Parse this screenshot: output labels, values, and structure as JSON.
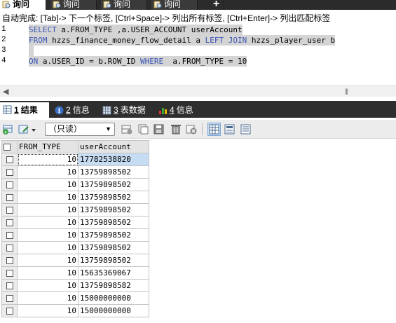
{
  "query_tabs": [
    {
      "label": "询问",
      "active": true
    },
    {
      "label": "询问",
      "active": false
    },
    {
      "label": "询问",
      "active": false
    },
    {
      "label": "询问",
      "active": false
    }
  ],
  "new_tab_label": "+",
  "hint": "自动完成: [Tab]-> 下一个标签, [Ctrl+Space]-> 列出所有标签, [Ctrl+Enter]-> 列出匹配标签",
  "editor": {
    "line_numbers": [
      "1",
      "2",
      "3",
      "4"
    ],
    "lines": [
      [
        {
          "t": "SELECT",
          "kw": true
        },
        {
          "t": " a.FROM_TYPE ,a.USER_ACCOUNT userAccount",
          "kw": false
        }
      ],
      [
        {
          "t": "FROM",
          "kw": true
        },
        {
          "t": " hzzs_finance_money_flow_detail a ",
          "kw": false
        },
        {
          "t": "LEFT JOIN",
          "kw": true
        },
        {
          "t": " hzzs_player_user b",
          "kw": false
        }
      ],
      [
        {
          "t": " ",
          "kw": false
        }
      ],
      [
        {
          "t": "ON",
          "kw": true
        },
        {
          "t": " a.USER_ID = b.ROW_ID ",
          "kw": false
        },
        {
          "t": "WHERE",
          "kw": true
        },
        {
          "t": "  a.FROM_TYPE = 10",
          "kw": false
        }
      ]
    ]
  },
  "result_tabs": [
    {
      "num": "1",
      "label": "结果",
      "icon": "grid-icon",
      "active": true
    },
    {
      "num": "2",
      "label": "信息",
      "icon": "info-icon",
      "active": false
    },
    {
      "num": "3",
      "label": "表数据",
      "icon": "table-icon",
      "active": false
    },
    {
      "num": "4",
      "label": "信息",
      "icon": "chart-icon",
      "active": false
    }
  ],
  "toolbar": {
    "readonly_label": "（只读）"
  },
  "grid": {
    "columns": [
      "FROM_TYPE",
      "userAccount"
    ],
    "rows": [
      [
        "10",
        "17782538820"
      ],
      [
        "10",
        "13759898502"
      ],
      [
        "10",
        "13759898502"
      ],
      [
        "10",
        "13759898502"
      ],
      [
        "10",
        "13759898502"
      ],
      [
        "10",
        "13759898502"
      ],
      [
        "10",
        "13759898502"
      ],
      [
        "10",
        "13759898502"
      ],
      [
        "10",
        "13759898502"
      ],
      [
        "10",
        "15635369067"
      ],
      [
        "10",
        "13759898582"
      ],
      [
        "10",
        "15000000000"
      ],
      [
        "10",
        "15000000000"
      ]
    ],
    "selected_row": 0
  },
  "colors": {
    "keyword": "#3a55b4",
    "selection": "#d4d4d4",
    "tab_bar": "#2e2e2e",
    "row_highlight": "#c6dcf3"
  }
}
